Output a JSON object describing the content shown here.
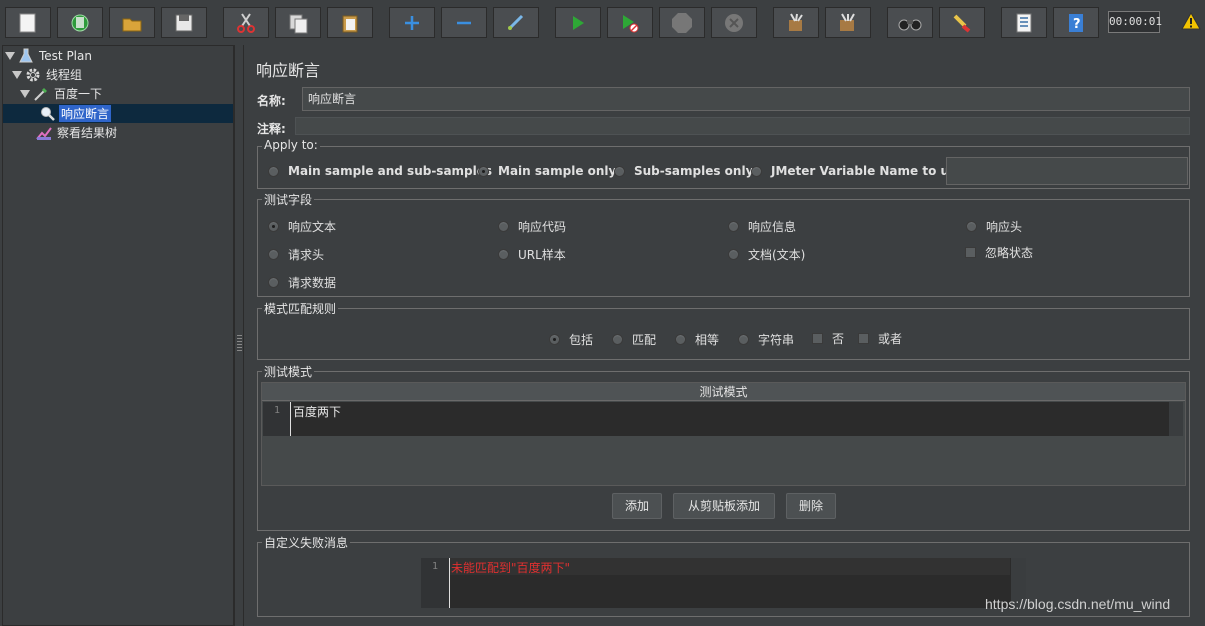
{
  "toolbar": {
    "buttons": [
      "new-icon",
      "templates-icon",
      "open-icon",
      "save-icon",
      "cut-icon",
      "copy-icon",
      "paste-icon",
      "expand-icon",
      "collapse-icon",
      "toggle-icon",
      "start-icon",
      "start-no-pause-icon",
      "stop-icon",
      "shutdown-icon",
      "clear-icon",
      "clear-all-icon",
      "search-icon",
      "reset-search-icon",
      "function-helper-icon",
      "help-icon"
    ],
    "timer": "00:00:01"
  },
  "tree": {
    "items": [
      {
        "label": "Test Plan"
      },
      {
        "label": "线程组"
      },
      {
        "label": "百度一下"
      },
      {
        "label": "响应断言"
      },
      {
        "label": "察看结果树"
      }
    ]
  },
  "panel": {
    "title": "响应断言",
    "name_label": "名称:",
    "name_value": "响应断言",
    "comment_label": "注释:"
  },
  "apply_to": {
    "legend": "Apply to:",
    "options": [
      "Main sample and sub-samples",
      "Main sample only",
      "Sub-samples only",
      "JMeter Variable Name to use"
    ],
    "selected": "Main sample only"
  },
  "test_field": {
    "legend": "测试字段",
    "options": [
      "响应文本",
      "响应代码",
      "响应信息",
      "响应头",
      "请求头",
      "URL样本",
      "文档(文本)",
      "请求数据"
    ],
    "checkbox": "忽略状态",
    "selected": "响应文本"
  },
  "pattern_rules": {
    "legend": "模式匹配规则",
    "radios": [
      "包括",
      "匹配",
      "相等",
      "字符串"
    ],
    "checks": [
      "否",
      "或者"
    ],
    "selected": "包括"
  },
  "patterns": {
    "legend": "测试模式",
    "header": "测试模式",
    "line_no": "1",
    "text": "百度两下",
    "add": "添加",
    "add_clipboard": "从剪贴板添加",
    "delete": "删除"
  },
  "failure": {
    "legend": "自定义失败消息",
    "line_no": "1",
    "text": "未能匹配到\"百度两下\"",
    "text_color": "#e03030"
  },
  "watermark": "https://blog.csdn.net/mu_wind"
}
